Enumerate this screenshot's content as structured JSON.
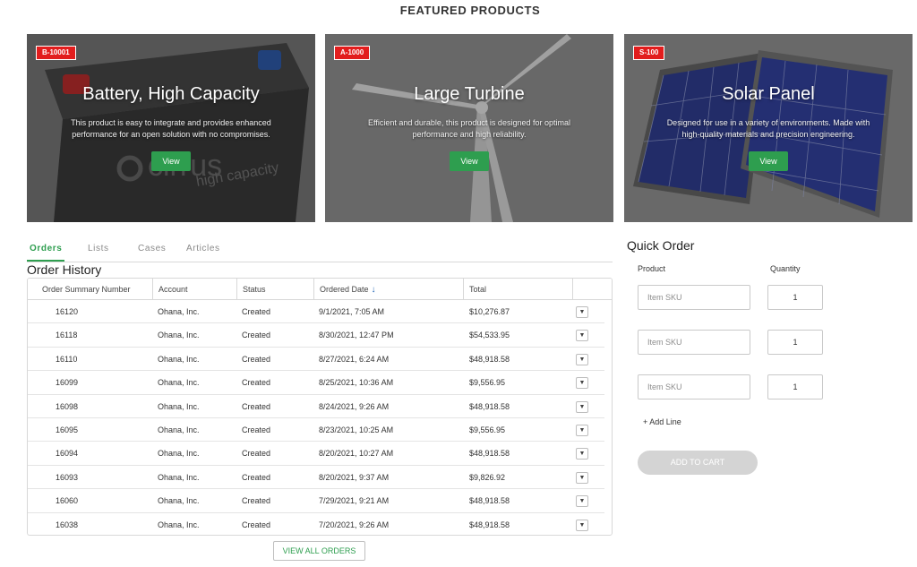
{
  "featured": {
    "heading": "FEATURED PRODUCTS",
    "products": [
      {
        "sku": "B-10001",
        "title": "Battery, High Capacity",
        "description": "This product is easy to integrate and provides enhanced performance for an open solution with no compromises.",
        "view_label": "View",
        "image_icon": "battery-image",
        "image_brand_text": "cirrus",
        "image_tagline_text": "high capacity"
      },
      {
        "sku": "A-1000",
        "title": "Large Turbine",
        "description": "Efficient and durable, this product is designed for optimal performance and high reliability.",
        "view_label": "View",
        "image_icon": "wind-turbine-image"
      },
      {
        "sku": "S-100",
        "title": "Solar Panel",
        "description": "Designed for use in a variety of environments. Made with high-quality materials and precision engineering.",
        "view_label": "View",
        "image_icon": "solar-panel-image"
      }
    ]
  },
  "tabs": [
    "Orders",
    "Lists",
    "Cases",
    "Articles"
  ],
  "active_tab": "Orders",
  "order_history": {
    "title": "Order History",
    "columns": [
      "Order Summary Number",
      "Account",
      "Status",
      "Ordered Date",
      "Total"
    ],
    "sort_icon": "arrow-down-icon",
    "rows": [
      [
        "16120",
        "Ohana, Inc.",
        "Created",
        "9/1/2021, 7:05 AM",
        "$10,276.87"
      ],
      [
        "16118",
        "Ohana, Inc.",
        "Created",
        "8/30/2021, 12:47 PM",
        "$54,533.95"
      ],
      [
        "16110",
        "Ohana, Inc.",
        "Created",
        "8/27/2021, 6:24 AM",
        "$48,918.58"
      ],
      [
        "16099",
        "Ohana, Inc.",
        "Created",
        "8/25/2021, 10:36 AM",
        "$9,556.95"
      ],
      [
        "16098",
        "Ohana, Inc.",
        "Created",
        "8/24/2021, 9:26 AM",
        "$48,918.58"
      ],
      [
        "16095",
        "Ohana, Inc.",
        "Created",
        "8/23/2021, 10:25 AM",
        "$9,556.95"
      ],
      [
        "16094",
        "Ohana, Inc.",
        "Created",
        "8/20/2021, 10:27 AM",
        "$48,918.58"
      ],
      [
        "16093",
        "Ohana, Inc.",
        "Created",
        "8/20/2021, 9:37 AM",
        "$9,826.92"
      ],
      [
        "16060",
        "Ohana, Inc.",
        "Created",
        "7/29/2021, 9:21 AM",
        "$48,918.58"
      ],
      [
        "16038",
        "Ohana, Inc.",
        "Created",
        "7/20/2021, 9:26 AM",
        "$48,918.58"
      ]
    ],
    "view_all_label": "VIEW ALL ORDERS"
  },
  "quick_order": {
    "title": "Quick Order",
    "product_label": "Product",
    "quantity_label": "Quantity",
    "lines": [
      {
        "sku_placeholder": "Item SKU",
        "quantity": "1"
      },
      {
        "sku_placeholder": "Item SKU",
        "quantity": "1"
      },
      {
        "sku_placeholder": "Item SKU",
        "quantity": "1"
      }
    ],
    "add_line_label": "+ Add Line",
    "add_to_cart_label": "ADD TO CART"
  },
  "colors": {
    "accent_green": "#2e9e4f",
    "badge_red": "#e21d1d",
    "sort_arrow_blue": "#1f63b5",
    "disabled_button": "#d4d4d4"
  }
}
